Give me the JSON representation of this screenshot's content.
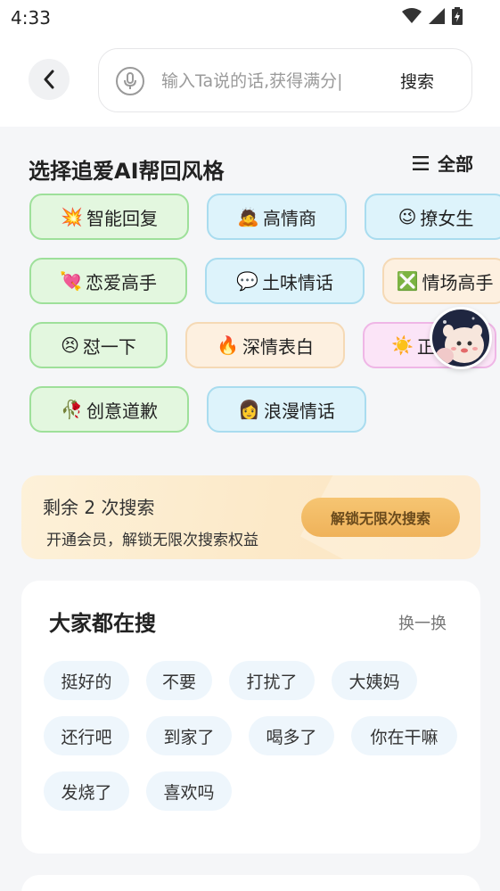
{
  "status": {
    "time": "4:33"
  },
  "search": {
    "placeholder": "输入Ta说的话,获得满分|",
    "button": "搜索"
  },
  "styles": {
    "title": "选择追爱AI帮回风格",
    "all_label": "全部",
    "chips": [
      {
        "label": "智能回复",
        "icon": "💥"
      },
      {
        "label": "高情商",
        "icon": "🙇"
      },
      {
        "label": "撩女生",
        "icon": "😉"
      },
      {
        "label": "恋爱高手",
        "icon": "💘"
      },
      {
        "label": "土味情话",
        "icon": "💬"
      },
      {
        "label": "情场高手",
        "icon": "❎"
      },
      {
        "label": "怼一下",
        "icon": "😣"
      },
      {
        "label": "深情表白",
        "icon": "🔥"
      },
      {
        "label": "正",
        "icon": "☀️"
      },
      {
        "label": "创意道歉",
        "icon": "🥀"
      },
      {
        "label": "浪漫情话",
        "icon": "👩"
      }
    ]
  },
  "promo": {
    "title": "剩余 2 次搜索",
    "subtitle": "开通会员，解锁无限次搜索权益",
    "button": "解锁无限次搜索"
  },
  "hot": {
    "title": "大家都在搜",
    "refresh": "换一换",
    "tags": [
      "挺好的",
      "不要",
      "打扰了",
      "大姨妈",
      "还行吧",
      "到家了",
      "喝多了",
      "你在干嘛",
      "发烧了",
      "喜欢吗"
    ]
  }
}
